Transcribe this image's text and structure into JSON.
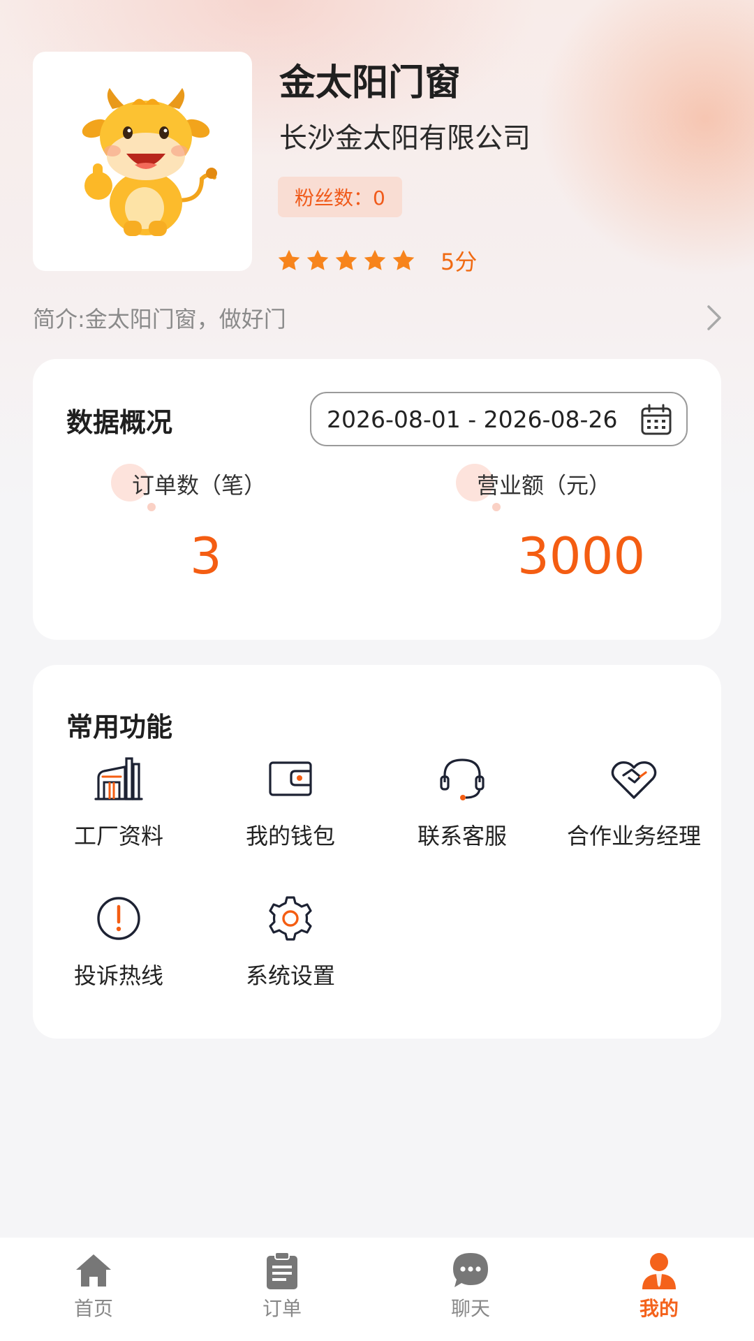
{
  "profile": {
    "shop_name": "金太阳门窗",
    "company_name": "长沙金太阳有限公司",
    "fans": "粉丝数：0",
    "rating": 5,
    "rating_text": "5分",
    "intro": "简介:金太阳门窗，做好门"
  },
  "overview": {
    "title": "数据概况",
    "date_range": "2026-08-01 - 2026-08-26",
    "stats": [
      {
        "label": "订单数（笔）",
        "value": "3"
      },
      {
        "label": "营业额（元）",
        "value": "3000"
      }
    ]
  },
  "functions": {
    "title": "常用功能",
    "items": [
      {
        "label": "工厂资料",
        "icon": "factory-icon"
      },
      {
        "label": "我的钱包",
        "icon": "wallet-icon"
      },
      {
        "label": "联系客服",
        "icon": "headset-icon"
      },
      {
        "label": "合作业务经理",
        "icon": "handshake-heart-icon"
      },
      {
        "label": "投诉热线",
        "icon": "alert-icon"
      },
      {
        "label": "系统设置",
        "icon": "gear-icon"
      }
    ]
  },
  "tabbar": {
    "items": [
      {
        "label": "首页",
        "icon": "home-icon"
      },
      {
        "label": "订单",
        "icon": "clipboard-icon"
      },
      {
        "label": "聊天",
        "icon": "chat-bubble-icon"
      },
      {
        "label": "我的",
        "icon": "user-icon",
        "active": true
      }
    ]
  },
  "colors": {
    "accent": "#f45d12",
    "star": "#f7841c",
    "badge_bg": "#f9ddd3",
    "icon_dark": "#1d2233"
  }
}
